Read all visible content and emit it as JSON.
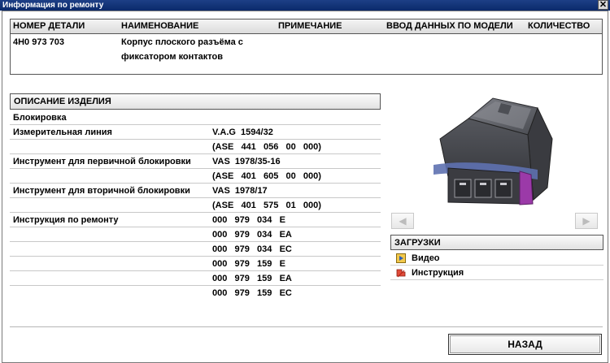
{
  "window": {
    "title": "Информация по ремонту"
  },
  "parts_table": {
    "headers": [
      "НОМЕР ДЕТАЛИ",
      "НАИМЕНОВАНИЕ",
      "ПРИМЕЧАНИЕ",
      "ВВОД ДАННЫХ ПО МОДЕЛИ",
      "КОЛИЧЕСТВО"
    ],
    "row": {
      "part_number": "4H0 973 703",
      "name_line1": "Корпус плоского разъёма с",
      "name_line2": "фиксатором контактов"
    }
  },
  "description": {
    "heading": "ОПИСАНИЕ ИЗДЕЛИЯ",
    "rows": [
      {
        "label": "Блокировка",
        "value": ""
      },
      {
        "label": "Измерительная линия",
        "value": "V.A.G  1594/32"
      },
      {
        "label": "",
        "value": "(ASE   441   056   00   000)"
      },
      {
        "label": "Инструмент для первичной блокировки",
        "value": "VAS  1978/35-16"
      },
      {
        "label": "",
        "value": "(ASE   401   605   00   000)"
      },
      {
        "label": "Инструмент для вторичной блокировки",
        "value": "VAS  1978/17"
      },
      {
        "label": "",
        "value": "(ASE   401   575   01   000)"
      },
      {
        "label": "Инструкция по ремонту",
        "value": "000   979   034   E"
      },
      {
        "label": "",
        "value": "000   979   034   EA"
      },
      {
        "label": "",
        "value": "000   979   034   EC"
      },
      {
        "label": "",
        "value": "000   979   159   E"
      },
      {
        "label": "",
        "value": "000   979   159   EA"
      },
      {
        "label": "",
        "value": "000   979   159   EC"
      }
    ]
  },
  "downloads": {
    "heading": "ЗАГРУЗКИ",
    "items": [
      {
        "label": "Видео",
        "icon": "video-icon"
      },
      {
        "label": "Инструкция",
        "icon": "pdf-icon"
      }
    ]
  },
  "buttons": {
    "back": "НАЗАД",
    "close": "✕"
  }
}
